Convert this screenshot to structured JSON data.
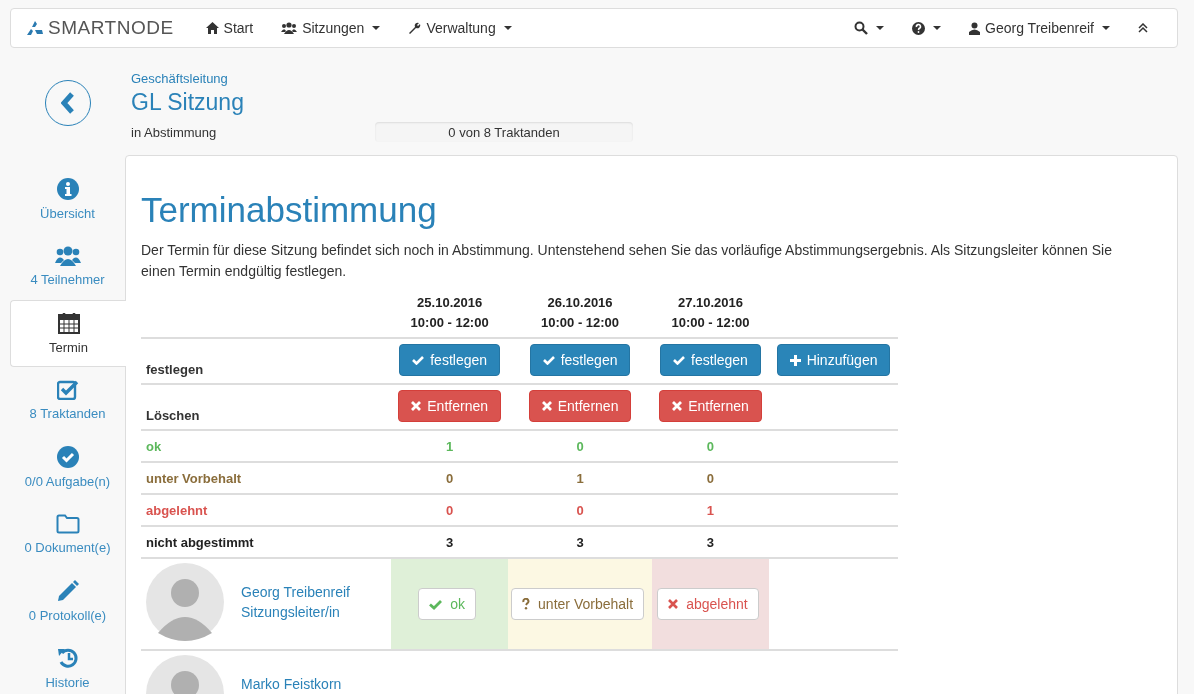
{
  "navbar": {
    "brand": "SMARTNODE",
    "items": [
      {
        "label": "Start",
        "dropdown": false
      },
      {
        "label": "Sitzungen",
        "dropdown": true
      },
      {
        "label": "Verwaltung",
        "dropdown": true
      }
    ],
    "right": [
      {
        "dropdown": true
      },
      {
        "dropdown": true
      },
      {
        "label": "Georg Treibenreif",
        "dropdown": true
      },
      {
        "dropdown": false
      }
    ]
  },
  "sidebar": {
    "items": [
      {
        "label": "Übersicht",
        "selected": false
      },
      {
        "label": "4 Teilnehmer",
        "selected": false
      },
      {
        "label": "Termin",
        "selected": true
      },
      {
        "label": "8 Traktanden",
        "selected": false
      },
      {
        "label": "0/0 Aufgabe(n)",
        "selected": false
      },
      {
        "label": "0 Dokument(e)",
        "selected": false
      },
      {
        "label": "0 Protokoll(e)",
        "selected": false
      },
      {
        "label": "Historie",
        "selected": false
      }
    ]
  },
  "header": {
    "group": "Geschäftsleitung",
    "title": "GL Sitzung",
    "status": "in Abstimmung",
    "progress": {
      "label": "0 von 8 Traktanden",
      "level": 0
    }
  },
  "poll": {
    "title": "Terminabstimmung",
    "description": "Der Termin für diese Sitzung befindet sich noch in Abstimmung. Untenstehend sehen Sie das vorläufige Abstimmungsergebnis. Als Sitzungsleiter können Sie einen Termin endgültig festlegen.",
    "dates": [
      {
        "date": "25.10.2016",
        "time": "10:00 - 12:00",
        "fix_button": "festlegen",
        "remove_button": "Entfernen"
      },
      {
        "date": "26.10.2016",
        "time": "10:00 - 12:00",
        "fix_button": "festlegen",
        "remove_button": "Entfernen"
      },
      {
        "date": "27.10.2016",
        "time": "10:00 - 12:00",
        "fix_button": "festlegen",
        "remove_button": "Entfernen"
      }
    ],
    "fix_label": "festlegen",
    "add_button": "Hinzufügen",
    "delete_label": "Löschen",
    "stats": [
      {
        "kind": "ok",
        "label": "ok",
        "values": [
          "1",
          "0",
          "0"
        ]
      },
      {
        "kind": "maybe",
        "label": "unter Vorbehalt",
        "values": [
          "0",
          "1",
          "0"
        ]
      },
      {
        "kind": "no",
        "label": "abgelehnt",
        "values": [
          "0",
          "0",
          "1"
        ]
      },
      {
        "kind": "none",
        "label": "nicht abgestimmt",
        "values": [
          "3",
          "3",
          "3"
        ]
      }
    ],
    "participants": [
      {
        "name": "Georg Treibenreif",
        "role": "Sitzungsleiter/in",
        "votes": [
          {
            "kind": "ok",
            "label": "ok"
          },
          {
            "kind": "maybe",
            "label": "unter Vorbehalt"
          },
          {
            "kind": "no",
            "label": "abgelehnt"
          }
        ]
      },
      {
        "name": "Marko Feistkorn"
      }
    ]
  }
}
